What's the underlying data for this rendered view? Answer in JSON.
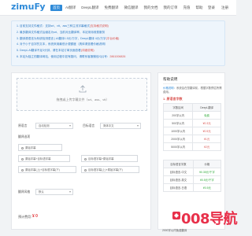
{
  "brand": {
    "logo": "zimuFy"
  },
  "nav": [
    "首页",
    "AI翻译",
    "DeepL翻译",
    "免费翻译",
    "微信翻译",
    "我的文档",
    "我的订单",
    "充值",
    "帮助"
  ],
  "auth": {
    "login": "登录",
    "register": "注册"
  },
  "notice": [
    {
      "text": "1. 目前支持文件格式：支持srt、vtt、ass三种主流字幕格式",
      "highlight": "(支持格式说明)"
    },
    {
      "text": "2. 最多翻译文件格式后缀名为srt、当前对比翻译率，本站采用收费服务",
      "highlight": ""
    },
    {
      "text": "3. 翻译源语言为系统检测语言 | AI翻译1.5元/万字，DeepL翻译 4元/万字",
      "highlight": "(平台价格)"
    },
    {
      "text": "4. 对于小于百字的文本，系统采用最低计费额度（具体请查看价格说明）",
      "highlight": ""
    },
    {
      "text": "5. DeepL AI翻译不足3分钟，请在本站订单页面查看",
      "highlight": "(详细说明)"
    },
    {
      "text": "6. 本站为独立的翻译网站，使用过程中如有疑问，请联系客服微信/QQ号：",
      "highlight": "2861006826"
    }
  ],
  "upload": {
    "text": "拖拽或上传字幕文件（srt、ass、vtt）"
  },
  "form": {
    "source_label": "原语言",
    "source_value": "自动检测",
    "target_label": "目标语言",
    "target_value": "简体中文",
    "options_label": "翻译选项",
    "options": [
      "原始字幕",
      "原始字幕+目标语字幕",
      "目标语字幕+原始字幕",
      "原始字幕(上)+目标语字幕(下)",
      "目标语字幕(上)+原始字幕(下)"
    ],
    "extra_label": "翻译风格",
    "extra_value": "默认",
    "price_label": "预计费用：",
    "price_value": "¥ 0"
  },
  "help": {
    "title": "帮助说明",
    "note_link": "价格说明",
    "note_text": "：系统会在您翻译前，根据字数预估所需费用。",
    "section1": "1. 原语言字数",
    "table1": {
      "headers": [
        "字数区间",
        "DeepL翻译"
      ],
      "rows": [
        [
          "200字以内",
          "免费"
        ],
        [
          "500字以内",
          "¥0.3元"
        ],
        [
          "1000字以内",
          "¥0.5元"
        ],
        [
          "2000字以内",
          "¥1元"
        ],
        [
          "5000字以内",
          "¥2元"
        ]
      ]
    },
    "table2": {
      "headers": [
        "目标语言字数",
        "价格"
      ],
      "rows": [
        [
          "目标语言-中文",
          "¥0.35元/千字"
        ],
        [
          "目标语言-英文",
          "¥0.5元/千字"
        ],
        [
          "目标语言-日语",
          "¥0.5元"
        ]
      ]
    },
    "bottom": "2000字以内免费翻译"
  },
  "watermark": "008导航"
}
